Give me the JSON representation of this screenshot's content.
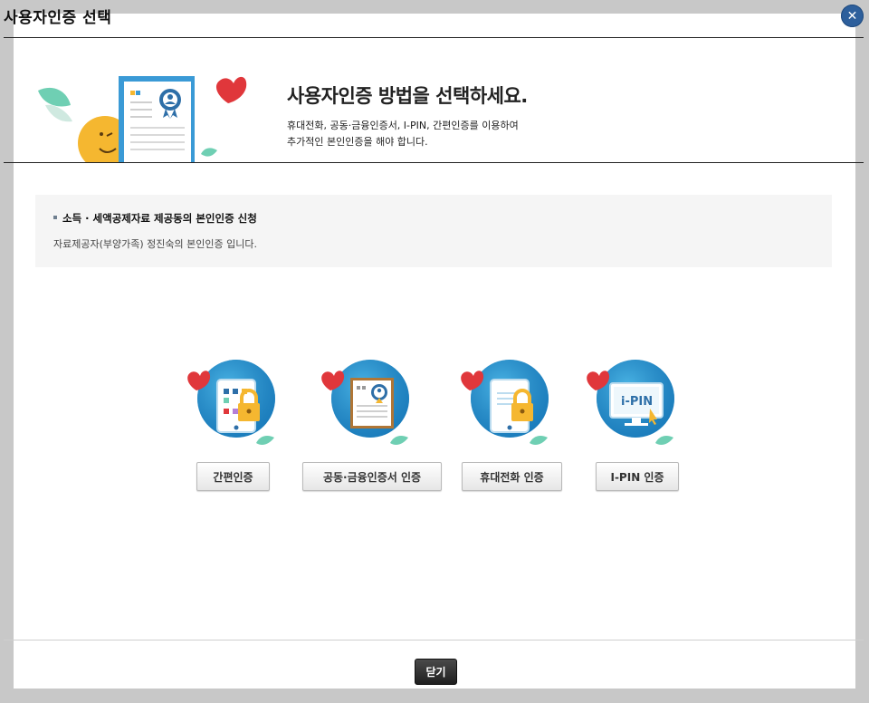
{
  "window": {
    "title": "사용자인증 선택",
    "close_icon": "close-icon"
  },
  "hero": {
    "heading": "사용자인증 방법을 선택하세요.",
    "desc_line1": "휴대전화, 공동·금융인증서, I-PIN, 간편인증를 이용하여",
    "desc_line2": "추가적인 본인인증을 해야 합니다."
  },
  "notice": {
    "title": "소득 · 세액공제자료 제공동의 본인인증 신청",
    "text": "자료제공자(부양가족) 정진숙의 본인인증 입니다."
  },
  "methods": [
    {
      "label": "간편인증",
      "icon": "simple-auth-icon"
    },
    {
      "label": "공동·금융인증서 인증",
      "icon": "certificate-icon"
    },
    {
      "label": "휴대전화 인증",
      "icon": "mobile-phone-icon"
    },
    {
      "label": "I-PIN 인증",
      "icon": "ipin-monitor-icon",
      "icon_text": "i-PIN"
    }
  ],
  "footer": {
    "close_label": "닫기"
  },
  "colors": {
    "accent": "#2d5f9c",
    "heart": "#e0373b",
    "globe": "#1e8fd0",
    "leaf": "#5cc4a8"
  }
}
